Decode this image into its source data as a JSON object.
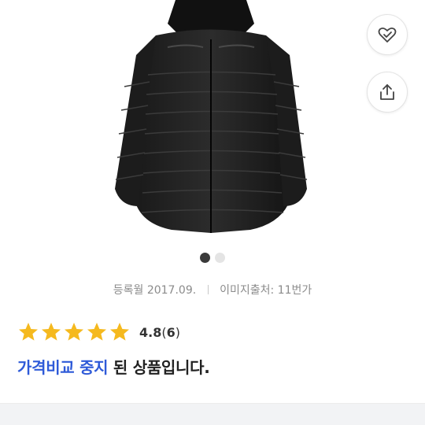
{
  "product": {
    "image_alt": "black hooded puffer jacket",
    "actions": {
      "wish_icon": "heart-check-icon",
      "share_icon": "share-icon"
    }
  },
  "carousel": {
    "total": 2,
    "active": 1
  },
  "meta": {
    "registered": "등록월 2017.09.",
    "source": "이미지출처: 11번가"
  },
  "rating": {
    "stars": 5,
    "value": "4.8",
    "count_open": "(",
    "count": "6",
    "count_close": ")",
    "star_color": "#f5b91e"
  },
  "notice": {
    "highlight": "가격비교 중지",
    "rest": " 된 상품입니다.",
    "highlight_color": "#2e5ad8"
  }
}
